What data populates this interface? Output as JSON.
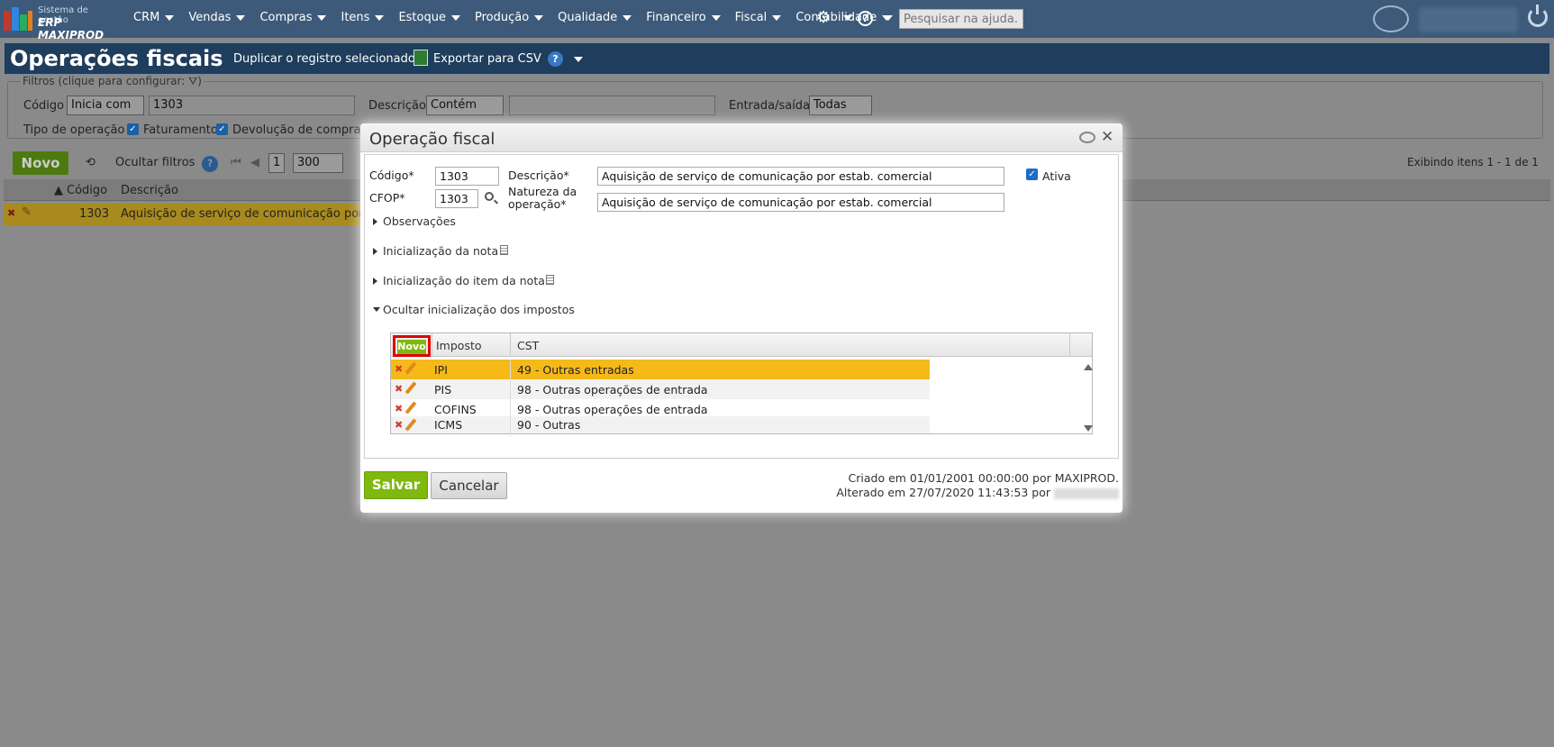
{
  "app": {
    "logo_line1": "Sistema de gestão",
    "logo_line2": "ERP MAXIPROD",
    "menu": [
      "CRM",
      "Vendas",
      "Compras",
      "Itens",
      "Estoque",
      "Produção",
      "Qualidade",
      "Financeiro",
      "Fiscal",
      "Contabilidade"
    ],
    "help_search_placeholder": "Pesquisar na ajuda..."
  },
  "page": {
    "title": "Operações fiscais",
    "duplicate_label": "Duplicar o registro selecionado",
    "export_label": "Exportar para CSV"
  },
  "filters": {
    "legend": "Filtros (clique para configurar:",
    "legend_end": ")",
    "codigo_label": "Código",
    "codigo_mode": "Inicia com",
    "codigo_value": "1303",
    "descricao_label": "Descrição",
    "descricao_mode": "Contém",
    "descricao_value": "",
    "entrada_label": "Entrada/saída",
    "entrada_value": "Todas",
    "tipo_label": "Tipo de operação",
    "tipo_opt1": "Faturamento",
    "tipo_opt2": "Devolução de compra"
  },
  "toolbar": {
    "novo": "Novo",
    "hide_filters": "Ocultar filtros",
    "page": "1",
    "page_size": "300",
    "showing": "Exibindo itens 1 - 1 de 1"
  },
  "grid": {
    "col_codigo": "Código",
    "col_descricao": "Descrição",
    "row_codigo": "1303",
    "row_descricao": "Aquisição de serviço de comunicação por es"
  },
  "modal": {
    "title": "Operação fiscal",
    "codigo_label": "Código*",
    "codigo_value": "1303",
    "cfop_label": "CFOP*",
    "cfop_value": "1303",
    "descricao_label": "Descrição*",
    "descricao_value": "Aquisição de serviço de comunicação por estab. comercial",
    "natureza_label_1": "Natureza da",
    "natureza_label_2": "operação*",
    "natureza_value": "Aquisição de serviço de comunicação por estab. comercial",
    "ativa_label": "Ativa",
    "sections": {
      "observacoes": "Observações",
      "init_nota": "Inicialização da nota",
      "init_item": "Inicialização do item da nota",
      "impostos": "Ocultar inicialização dos impostos"
    },
    "tax_table": {
      "novo": "Novo",
      "col_imposto": "Imposto",
      "col_cst": "CST",
      "rows": [
        {
          "imposto": "IPI",
          "cst": "49 - Outras entradas"
        },
        {
          "imposto": "PIS",
          "cst": "98 - Outras operações de entrada"
        },
        {
          "imposto": "COFINS",
          "cst": "98 - Outras operações de entrada"
        },
        {
          "imposto": "ICMS",
          "cst": "90 - Outras"
        }
      ]
    },
    "save": "Salvar",
    "cancel": "Cancelar",
    "created": "Criado em 01/01/2001 00:00:00 por MAXIPROD.",
    "altered": "Alterado em 27/07/2020 11:43:53 por"
  },
  "colors": {
    "nav_bg": "#3d5a7a",
    "save_green": "#7fb80e",
    "selected_row": "#f5b91a",
    "highlight_red": "#e00000"
  }
}
